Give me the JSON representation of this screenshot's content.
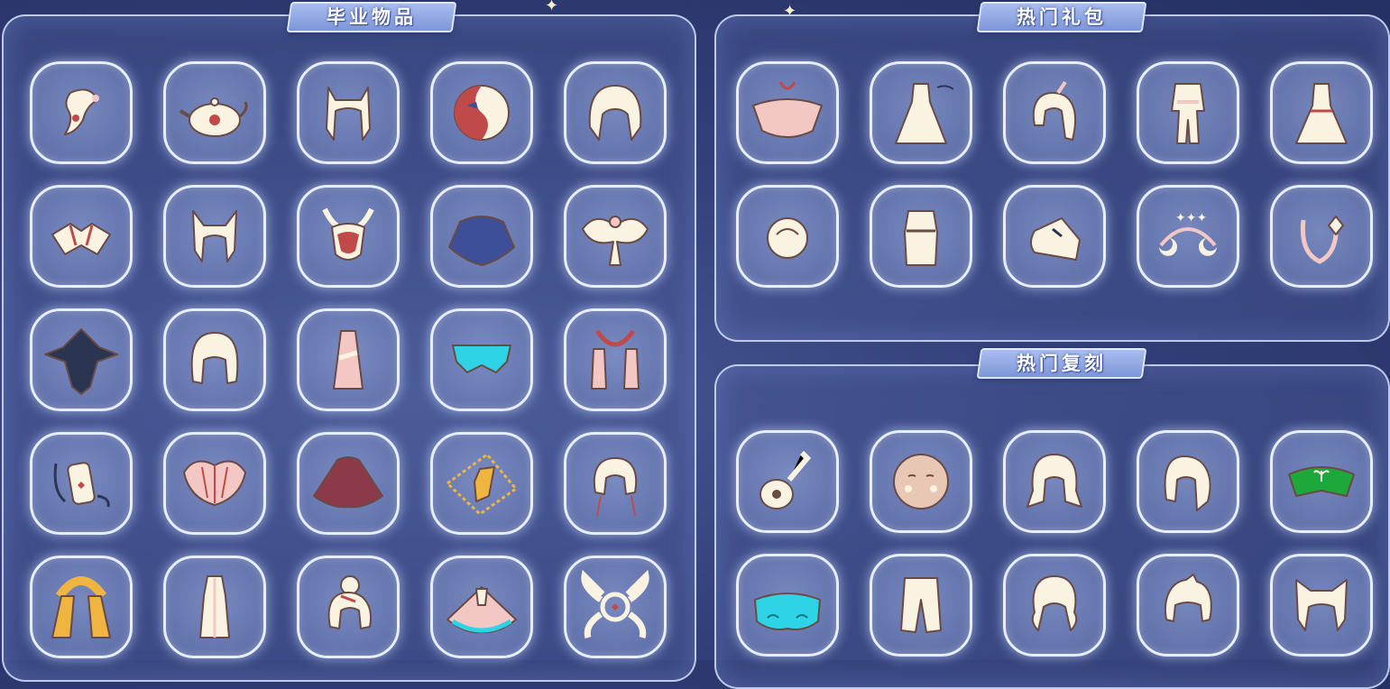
{
  "sections": {
    "graduation": {
      "title": "毕业物品"
    },
    "hot_gifts": {
      "title": "热门礼包"
    },
    "hot_rerun": {
      "title": "热门复刻"
    }
  },
  "graduation_items": [
    "hair-pink-ornament-icon",
    "teapot-hat-icon",
    "hair-cat-ears-icon",
    "mask-half-icon",
    "hair-long-icon",
    "cape-lotus-icon",
    "hair-fox-ears-icon",
    "mask-red-horn-icon",
    "cape-blue-icon",
    "cape-butterfly-icon",
    "cape-dark-feather-icon",
    "hair-bob-icon",
    "outfit-pink-robe-icon",
    "cape-cyan-icon",
    "scarf-pink-icon",
    "accessory-lantern-icon",
    "cape-pink-shell-icon",
    "cape-burgundy-icon",
    "necklace-gold-icon",
    "hair-feather-icon",
    "scarf-gold-icon",
    "outfit-white-robe-icon",
    "hair-bun-icon",
    "cape-pastel-icon",
    "accessory-wing-halo-icon"
  ],
  "gift_items": [
    "cape-pink-gem-icon",
    "outfit-dress-icon",
    "hair-ponytail-icon",
    "outfit-suit-icon",
    "outfit-white-dress-icon",
    "hair-small-bun-icon",
    "outfit-scarf-icon",
    "shoes-white-icon",
    "headband-moon-icon",
    "accessory-tail-icon"
  ],
  "rerun_items": [
    "guitar-icon",
    "mask-blush-icon",
    "hair-twin-icon",
    "hair-side-ponytail-icon",
    "cape-green-icon",
    "cape-cyan-cloud-icon",
    "pants-white-icon",
    "hair-wavy-icon",
    "hair-short-icon",
    "hair-cat-ear-icon"
  ],
  "colors": {
    "background": "#33407a",
    "panel_border": "#d6e2ff",
    "tab": "#8aa0de",
    "slot": "#7485c0",
    "item_cream": "#fbf3e2",
    "item_pink": "#f3c8c4",
    "item_red": "#c04a4a",
    "item_blue": "#3d4f98",
    "item_cyan": "#2fd3e6",
    "item_green": "#1da83c",
    "item_gold": "#f0b440",
    "item_dark": "#2b3450"
  }
}
